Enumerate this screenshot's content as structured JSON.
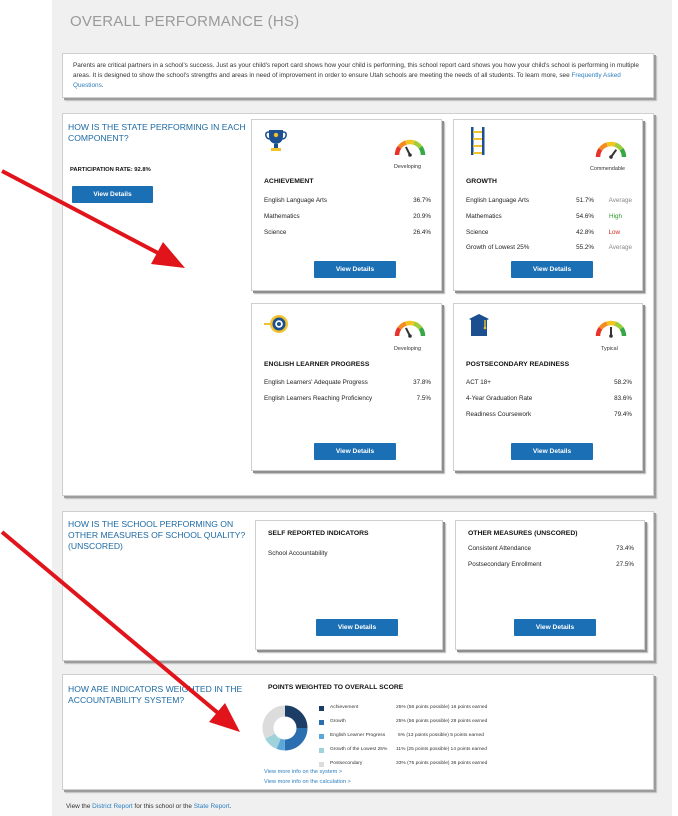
{
  "header": {
    "title": "OVERALL PERFORMANCE (HS)"
  },
  "intro": {
    "text": "Parents are critical partners in a school's success. Just as your child's report card shows how your child is performing, this school report card shows you how your child's school is performing in multiple areas. It is designed to show the school's strengths and areas in need of improvement in order to ensure Utah schools are meeting the needs of all students. To learn more, see ",
    "link": "Frequently Asked Questions",
    "suffix": "."
  },
  "state_section": {
    "heading": "HOW IS THE STATE PERFORMING IN EACH COMPONENT?",
    "participation": "PARTICIPATION RATE: 92.8%",
    "button": "View Details"
  },
  "cards": {
    "achievement": {
      "title": "ACHIEVEMENT",
      "rating": "Developing",
      "gauge_level": 0.35,
      "rows": [
        {
          "label": "English Language Arts",
          "value": "36.7%"
        },
        {
          "label": "Mathematics",
          "value": "20.9%"
        },
        {
          "label": "Science",
          "value": "26.4%"
        }
      ],
      "button": "View Details"
    },
    "growth": {
      "title": "GROWTH",
      "rating": "Commendable",
      "gauge_level": 0.7,
      "rows": [
        {
          "label": "English Language Arts",
          "value": "51.7%",
          "rating": "Average",
          "color": "#888888"
        },
        {
          "label": "Mathematics",
          "value": "54.6%",
          "rating": "High",
          "color": "#2e9a2e"
        },
        {
          "label": "Science",
          "value": "42.8%",
          "rating": "Low",
          "color": "#d42a2a"
        },
        {
          "label": "Growth of Lowest 25%",
          "value": "55.2%",
          "rating": "Average",
          "color": "#888888"
        }
      ],
      "button": "View Details"
    },
    "elp": {
      "title": "ENGLISH LEARNER PROGRESS",
      "rating": "Developing",
      "gauge_level": 0.35,
      "rows": [
        {
          "label": "English Learners' Adequate Progress",
          "value": "37.8%"
        },
        {
          "label": "English Learners Reaching Proficiency",
          "value": "7.5%"
        }
      ],
      "button": "View Details"
    },
    "postsecondary": {
      "title": "POSTSECONDARY READINESS",
      "rating": "Typical",
      "gauge_level": 0.5,
      "rows": [
        {
          "label": "ACT 18+",
          "value": "58.2%"
        },
        {
          "label": "4-Year Graduation Rate",
          "value": "83.6%"
        },
        {
          "label": "Readiness Coursework",
          "value": "79.4%"
        }
      ],
      "button": "View Details"
    }
  },
  "quality_section": {
    "heading": "HOW IS THE SCHOOL PERFORMING ON OTHER MEASURES OF SCHOOL QUALITY? (UNSCORED)",
    "self_reported": {
      "title": "SELF REPORTED INDICATORS",
      "item": "School Accountability",
      "button": "View Details"
    },
    "other_measures": {
      "title": "OTHER MEASURES (UNSCORED)",
      "rows": [
        {
          "label": "Consistent Attendance",
          "value": "73.4%"
        },
        {
          "label": "Postsecondary Enrollment",
          "value": "27.5%"
        }
      ],
      "button": "View Details"
    }
  },
  "weighted_section": {
    "heading": "HOW ARE INDICATORS WEIGHTED IN THE ACCOUNTABILITY SYSTEM?",
    "title": "POINTS WEIGHTED TO OVERALL SCORE",
    "legend": [
      {
        "name": "Achievement",
        "points": "25% (56 points possible) 16 points earned",
        "color": "#1b3d66",
        "share": 25
      },
      {
        "name": "Growth",
        "points": "25% (56 points possible) 28 points earned",
        "color": "#2c6fb0",
        "share": 25
      },
      {
        "name": "English Learner Progress",
        "points": "6% (13 points possible) 5 points earned",
        "color": "#5ba7d8",
        "share": 6
      },
      {
        "name": "Growth of the Lowest 25%",
        "points": "11% (25 points possible) 14 points earned",
        "color": "#9fd3dc",
        "share": 11
      },
      {
        "name": "Postsecondary",
        "points": "33% (75 points possible) 36 points earned",
        "color": "#dcdcdc",
        "share": 33
      }
    ],
    "link_system": "View more info on the system >",
    "link_calc": "View more info on the calculation >"
  },
  "footer": {
    "prefix": "View the ",
    "district_link": "District Report",
    "middle": " for this school or the ",
    "state_link": "State Report",
    "suffix": "."
  },
  "colors": {
    "accent": "#1b6fb5",
    "heading": "#1d6aa3",
    "arrow": "#e0141a"
  }
}
